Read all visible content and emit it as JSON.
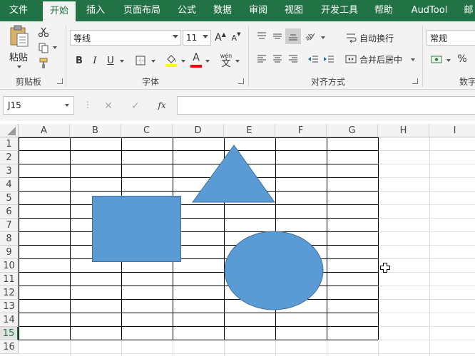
{
  "tabs": [
    {
      "label": "文件",
      "active": false
    },
    {
      "label": "开始",
      "active": true
    },
    {
      "label": "插入",
      "active": false
    },
    {
      "label": "页面布局",
      "active": false
    },
    {
      "label": "公式",
      "active": false
    },
    {
      "label": "数据",
      "active": false
    },
    {
      "label": "审阅",
      "active": false
    },
    {
      "label": "视图",
      "active": false
    },
    {
      "label": "开发工具",
      "active": false
    },
    {
      "label": "帮助",
      "active": false
    },
    {
      "label": "AudTool",
      "active": false
    },
    {
      "label": "邮",
      "active": false
    }
  ],
  "ribbon": {
    "clipboard": {
      "paste_label": "粘贴",
      "group_label": "剪贴板"
    },
    "font": {
      "font_name": "等线",
      "font_size": "11",
      "bold": "B",
      "italic": "I",
      "underline": "U",
      "phonetic": "wén",
      "phonetic_char": "文",
      "group_label": "字体",
      "grow": "A",
      "shrink": "A"
    },
    "alignment": {
      "wrap_text": "自动换行",
      "merge_center": "合并后居中",
      "group_label": "对齐方式"
    },
    "number": {
      "format": "常规",
      "percent": "%",
      "group_label": "数字"
    }
  },
  "formula_bar": {
    "name_box": "J15",
    "fx": "fx",
    "formula": ""
  },
  "columns": [
    "A",
    "B",
    "C",
    "D",
    "E",
    "F",
    "G",
    "H",
    "I"
  ],
  "rows": [
    "1",
    "2",
    "3",
    "4",
    "5",
    "6",
    "7",
    "8",
    "9",
    "10",
    "11",
    "12",
    "13",
    "14",
    "15",
    "16"
  ],
  "selected_row": "15",
  "colors": {
    "brand": "#217346",
    "shape_fill": "#5b9bd5",
    "shape_stroke": "#41719c",
    "font_color": "#ff0000",
    "highlight": "#ffff00"
  },
  "shapes": [
    "triangle",
    "rectangle",
    "ellipse"
  ]
}
